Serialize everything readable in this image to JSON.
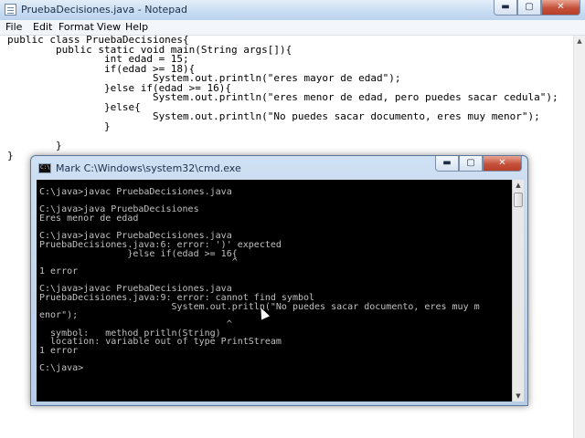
{
  "notepad": {
    "title": "PruebaDecisiones.java - Notepad",
    "menu": [
      {
        "label": "File"
      },
      {
        "label": "Edit"
      },
      {
        "label": "Format"
      },
      {
        "label": "View"
      },
      {
        "label": "Help"
      }
    ],
    "text": "public class PruebaDecisiones{\n        public static void main(String args[]){\n                int edad = 15;\n                if(edad >= 18){\n                        System.out.println(\"eres mayor de edad\");\n                }else if(edad >= 16){\n                        System.out.println(\"eres menor de edad, pero puedes sacar cedula\");\n                }else{\n                        System.out.println(\"No puedes sacar documento, eres muy menor\");\n                }\n\n        }\n}"
  },
  "cmd": {
    "title": "Mark C:\\Windows\\system32\\cmd.exe",
    "icon_text": "C:\\",
    "output": "C:\\java>javac PruebaDecisiones.java\n\nC:\\java>java PruebaDecisiones\nEres menor de edad\n\nC:\\java>javac PruebaDecisiones.java\nPruebaDecisiones.java:6: error: ')' expected\n                }else if(edad >= 16{\n                                   ^\n1 error\n\nC:\\java>javac PruebaDecisiones.java\nPruebaDecisiones.java:9: error: cannot find symbol\n                        System.out.pritln(\"No puedes sacar documento, eres muy m\nenor\");\n                                  ^\n  symbol:   method pritln(String)\n  location: variable out of type PrintStream\n1 error\n\nC:\\java>"
  },
  "icons": {
    "minimize": "minimize-icon",
    "maximize": "maximize-icon",
    "close": "close-icon"
  }
}
